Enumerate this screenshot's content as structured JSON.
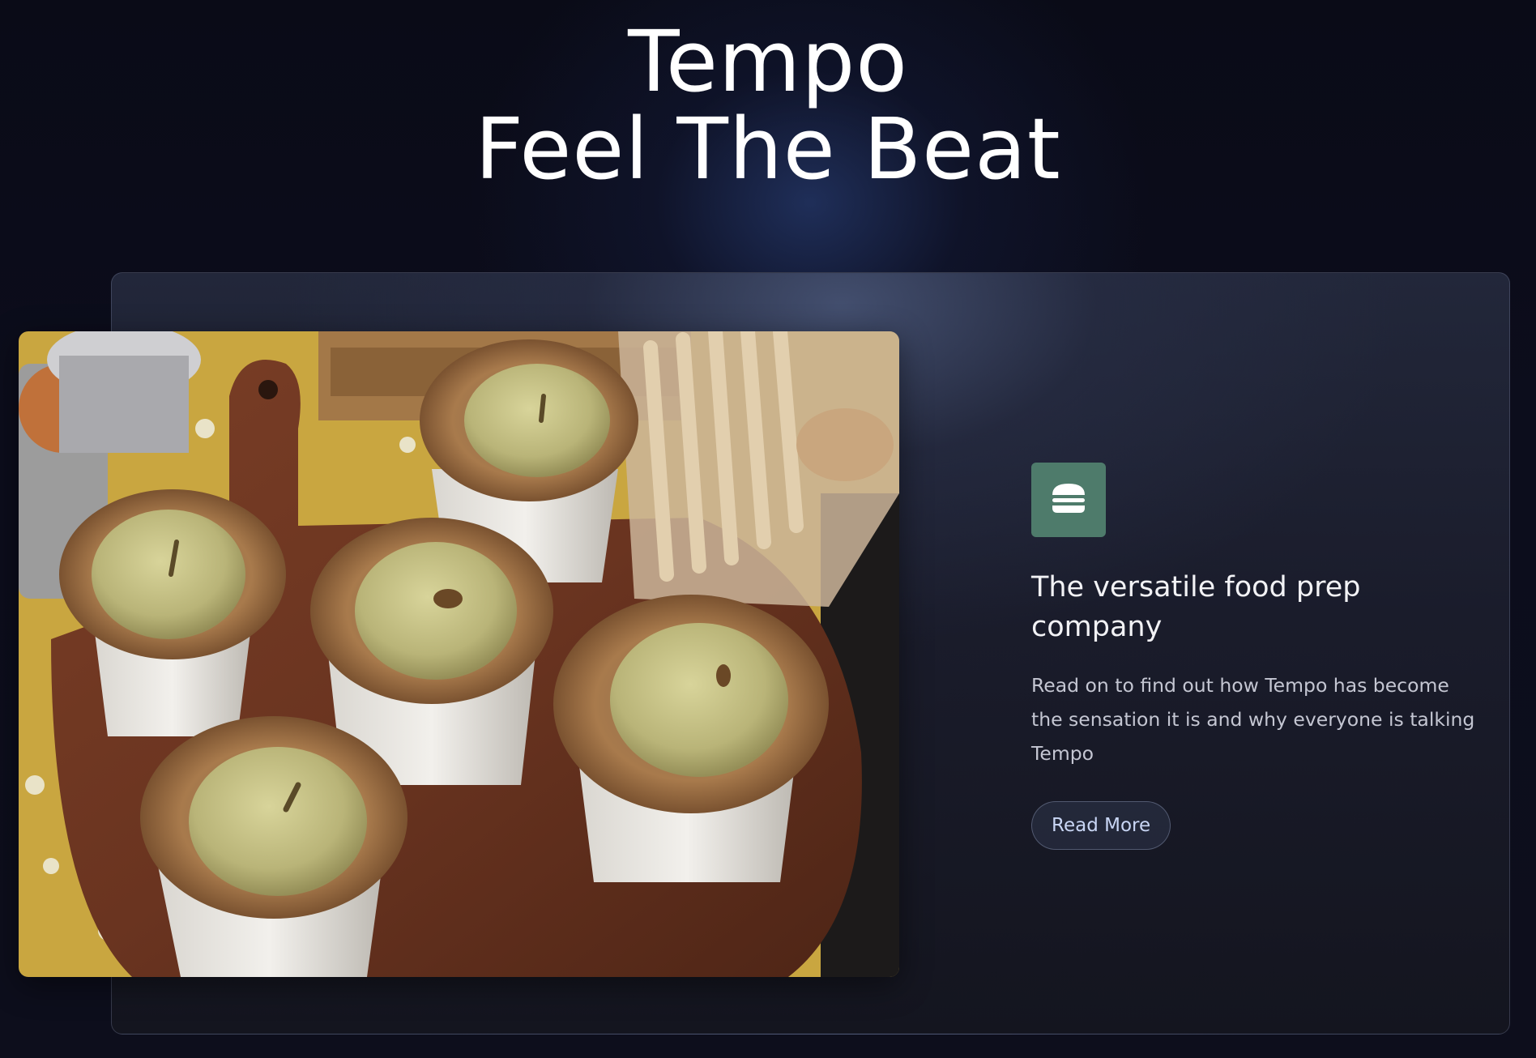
{
  "hero": {
    "line1": "Tempo",
    "line2": "Feel The Beat"
  },
  "feature": {
    "image_alt": "Meat pies in paper cups on a wooden board",
    "icon": "burger-icon",
    "icon_bg": "#4e7b6b",
    "title": "The versatile food prep company",
    "description": "Read on to find out how Tempo has become the sensation it is and why everyone is talking Tempo",
    "button_label": "Read More"
  }
}
